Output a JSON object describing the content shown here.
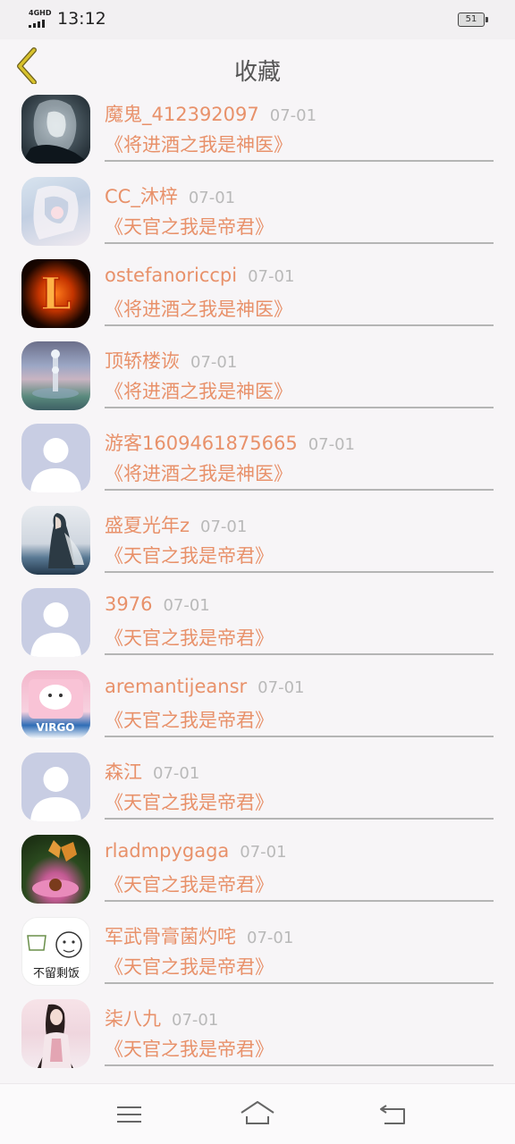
{
  "status_bar": {
    "network_type": "4GHD",
    "time": "13:12",
    "battery_level": "51"
  },
  "header": {
    "title": "收藏",
    "back_icon": "chevron-left-icon",
    "accent_color": "#c9b327"
  },
  "favorites": [
    {
      "username": "魔鬼_412392097",
      "date": "07-01",
      "book": "《将进酒之我是神医》",
      "avatar": "dark-ink-girl"
    },
    {
      "username": "CC_沐梓",
      "date": "07-01",
      "book": "《天官之我是帝君》",
      "avatar": "pale-anime-girl"
    },
    {
      "username": "ostefanoriccpi",
      "date": "07-01",
      "book": "《将进酒之我是神医》",
      "avatar": "flame-letter-L"
    },
    {
      "username": "顶轿楼诙",
      "date": "07-01",
      "book": "《将进酒之我是神医》",
      "avatar": "water-droplet"
    },
    {
      "username": "游客1609461875665",
      "date": "07-01",
      "book": "《将进酒之我是神医》",
      "avatar": "default-person"
    },
    {
      "username": "盛夏光年z",
      "date": "07-01",
      "book": "《天官之我是帝君》",
      "avatar": "ancient-figure-lake"
    },
    {
      "username": "3976",
      "date": "07-01",
      "book": "《天官之我是帝君》",
      "avatar": "default-person"
    },
    {
      "username": "aremantijeansr",
      "date": "07-01",
      "book": "《天官之我是帝君》",
      "avatar": "virgo-cartoon"
    },
    {
      "username": "森江",
      "date": "07-01",
      "book": "《天官之我是帝君》",
      "avatar": "default-person"
    },
    {
      "username": "rladmpygaga",
      "date": "07-01",
      "book": "《天官之我是帝君》",
      "avatar": "butterfly-flower"
    },
    {
      "username": "军武骨膏菌灼咤",
      "date": "07-01",
      "book": "《天官之我是帝君》",
      "avatar": "meme-sketch"
    },
    {
      "username": "柒八九",
      "date": "07-01",
      "book": "《天官之我是帝君》",
      "avatar": "hanfu-girl"
    }
  ],
  "avatar_meme_text": "不留剩饭",
  "avatar_virgo_text": "VIRGO",
  "avatar_flame_letter": "L",
  "colors": {
    "name_color": "#e8916a",
    "date_color": "#b9b9b9",
    "divider_color": "#b5b5b5",
    "background": "#f7f5f7"
  },
  "nav_bar": {
    "menu_icon": "menu-icon",
    "home_icon": "home-icon",
    "back_icon": "return-icon"
  }
}
